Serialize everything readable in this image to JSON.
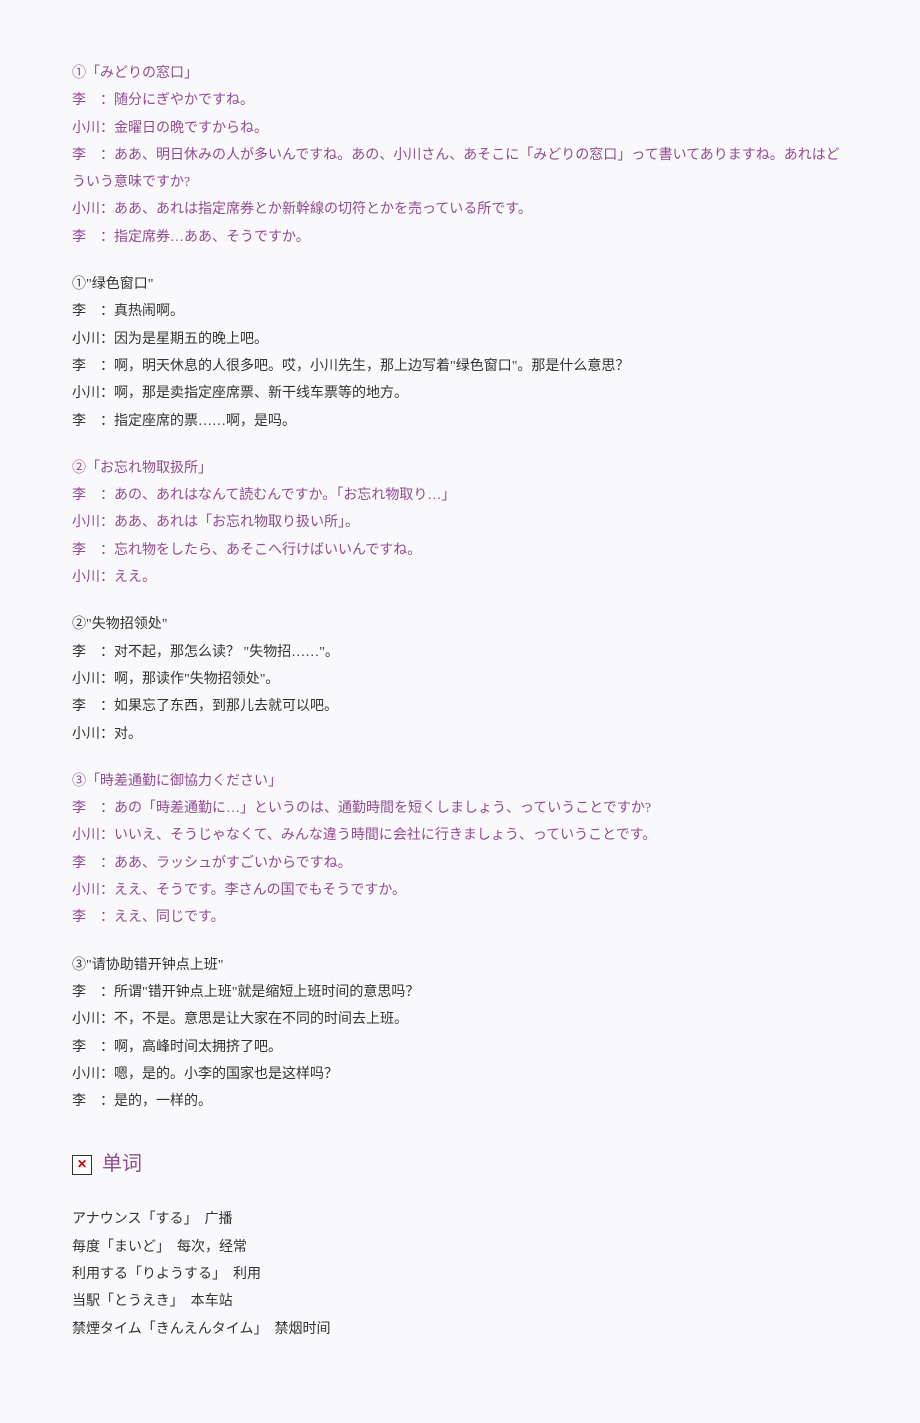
{
  "d1": {
    "jp_title": "①「みどりの窓口」",
    "jp": [
      "李　：随分にぎやかですね。",
      "小川：金曜日の晩ですからね。",
      "李　：ああ、明日休みの人が多いんですね。あの、小川さん、あそこに「みどりの窓口」って書いてありますね。あれはどういう意味ですか?",
      "小川：ああ、あれは指定席券とか新幹線の切符とかを売っている所です。",
      "李　：指定席券…ああ、そうですか。"
    ],
    "cn_title": "①\"绿色窗口\"",
    "cn": [
      "李　：真热闹啊。",
      "小川：因为是星期五的晚上吧。",
      "李　：啊，明天休息的人很多吧。哎，小川先生，那上边写着\"绿色窗口\"。那是什么意思？",
      "小川：啊，那是卖指定座席票、新干线车票等的地方。",
      "李　：指定座席的票……啊，是吗。"
    ]
  },
  "d2": {
    "jp_title": "②「お忘れ物取扱所」",
    "jp": [
      "李　：あの、あれはなんて読むんですか。「お忘れ物取り…」",
      "小川：ああ、あれは「お忘れ物取り扱い所」。",
      "李　：忘れ物をしたら、あそこへ行けばいいんですね。",
      "小川：ええ。"
    ],
    "cn_title": "②\"失物招领处\"",
    "cn": [
      "李　：对不起，那怎么读？ \"失物招……\"。",
      "小川：啊，那读作\"失物招领处\"。",
      "李　：如果忘了东西，到那儿去就可以吧。",
      "小川：对。"
    ]
  },
  "d3": {
    "jp_title": "③「時差通勤に御協力ください」",
    "jp": [
      "李　：あの「時差通勤に…」というのは、通勤時間を短くしましょう、っていうことですか?",
      "小川：いいえ、そうじゃなくて、みんな違う時間に会社に行きましょう、っていうことです。",
      "李　：ああ、ラッシュがすごいからですね。",
      "小川：ええ、そうです。李さんの国でもそうですか。",
      "李　：ええ、同じです。"
    ],
    "cn_title": "③\"请协助错开钟点上班\"",
    "cn": [
      "李　：所谓\"错开钟点上班\"就是缩短上班时间的意思吗？",
      "小川：不，不是。意思是让大家在不同的时间去上班。",
      "李　：啊，高峰时间太拥挤了吧。",
      "小川：嗯，是的。小李的国家也是这样吗？",
      "李　：是的，一样的。"
    ]
  },
  "vocab_heading": "单词",
  "vocab": [
    "アナウンス「する」　广播",
    "毎度「まいど」　每次，经常",
    "利用する「りようする」　利用",
    "当駅「とうえき」　本车站",
    "禁煙タイム「きんえんタイム」　禁烟时间"
  ]
}
